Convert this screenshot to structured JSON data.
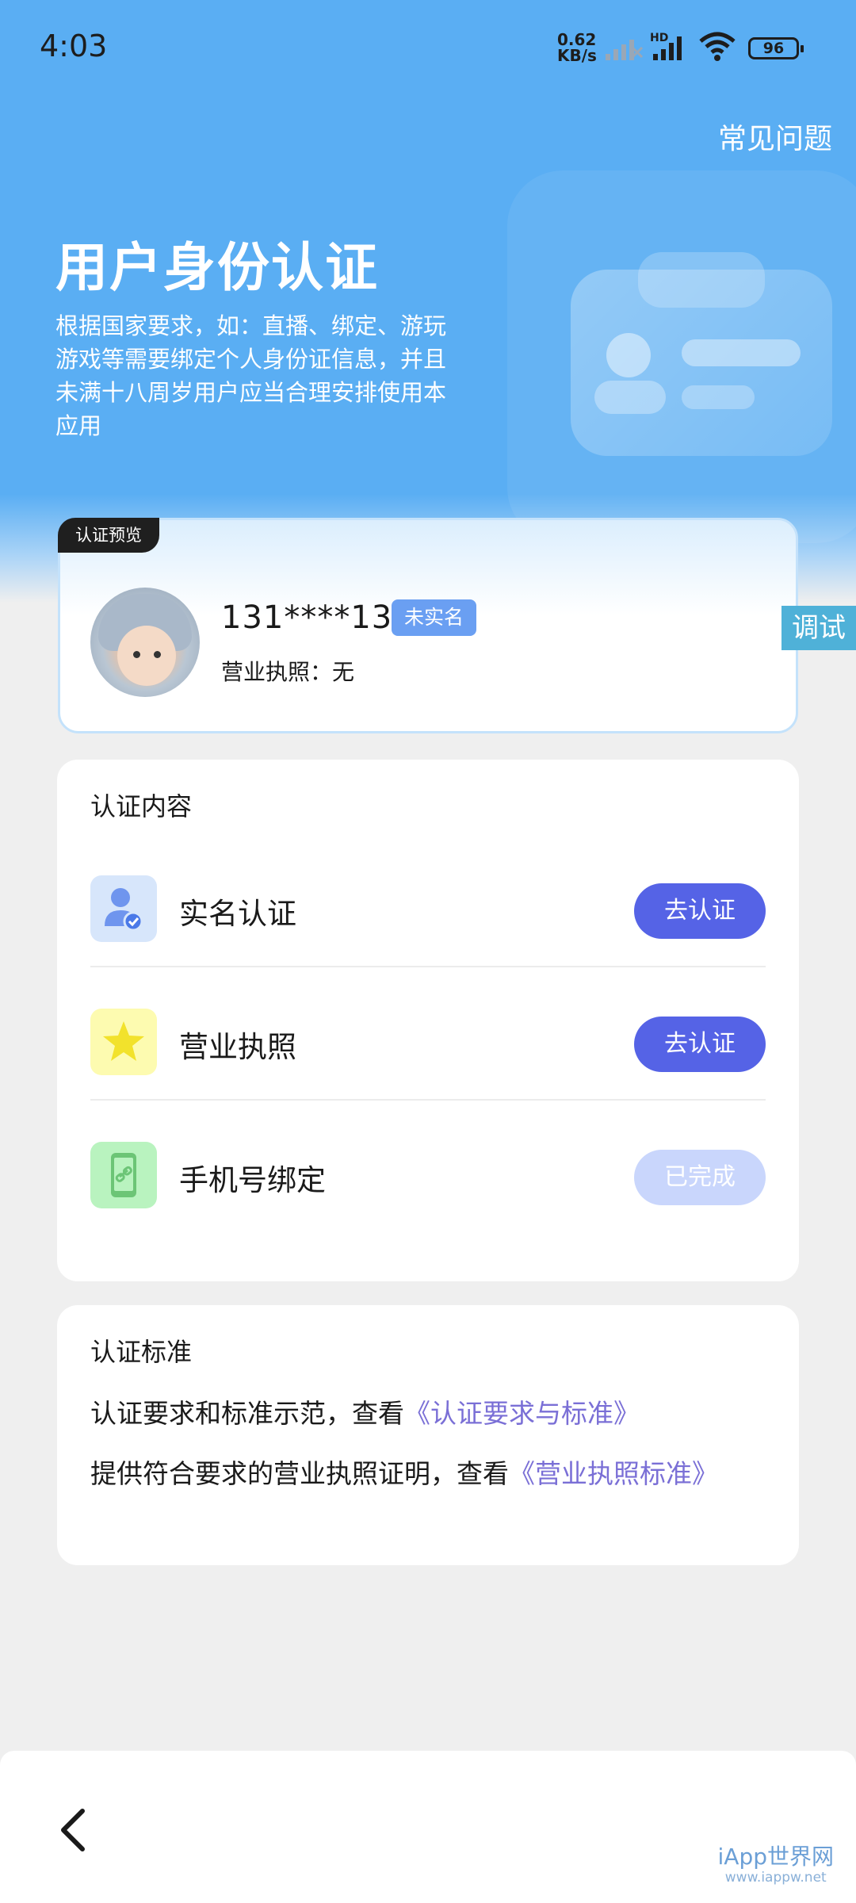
{
  "status_bar": {
    "time": "4:03",
    "net_speed_value": "0.62",
    "net_speed_unit": "KB/s",
    "hd_label": "HD",
    "battery": "96"
  },
  "header": {
    "faq_label": "常见问题",
    "title": "用户身份认证",
    "description": "根据国家要求，如：直播、绑定、游玩游戏等需要绑定个人身份证信息，并且未满十八周岁用户应当合理安排使用本应用"
  },
  "preview": {
    "tag": "认证预览",
    "phone": "131****134",
    "badge": "未实名",
    "license_text": "营业执照：无"
  },
  "debug_label": "调试",
  "auth": {
    "title": "认证内容",
    "items": [
      {
        "label": "实名认证",
        "button": "去认证",
        "state": "pending",
        "icon": "user-check-icon"
      },
      {
        "label": "营业执照",
        "button": "去认证",
        "state": "pending",
        "icon": "star-icon"
      },
      {
        "label": "手机号绑定",
        "button": "已完成",
        "state": "done",
        "icon": "phone-link-icon"
      }
    ]
  },
  "standards": {
    "title": "认证标准",
    "line1_text": "认证要求和标准示范，查看",
    "line1_link": "《认证要求与标准》",
    "line2_text": "提供符合要求的营业执照证明，查看",
    "line2_link": "《营业执照标准》"
  },
  "footer": {
    "watermark_main": "iApp世界网",
    "watermark_sub": "www.iappw.net"
  },
  "colors": {
    "header_bg": "#5aaef3",
    "primary_button": "#5563e6",
    "done_button": "#c9d6fc",
    "link": "#7a6fd6",
    "badge": "#6a9ff2"
  }
}
